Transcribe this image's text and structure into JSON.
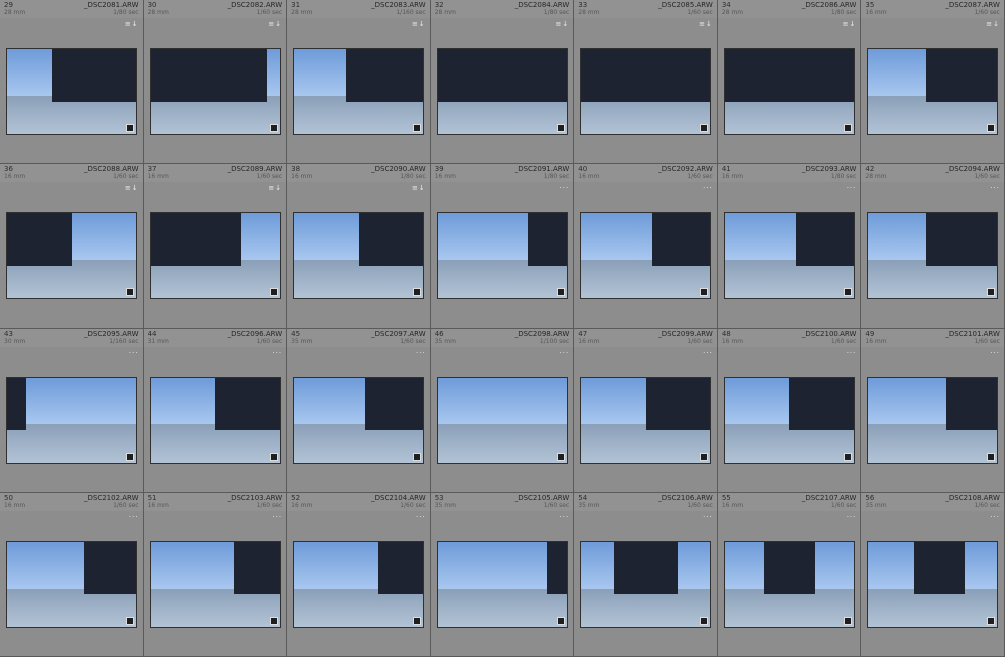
{
  "thumbnails": [
    {
      "index": "29",
      "filename": "_DSC2081.ARW",
      "focal": "28 mm",
      "shutter": "1/80 sec",
      "meta_icon": "≡↓"
    },
    {
      "index": "30",
      "filename": "_DSC2082.ARW",
      "focal": "28 mm",
      "shutter": "1/60 sec",
      "meta_icon": "≡↓"
    },
    {
      "index": "31",
      "filename": "_DSC2083.ARW",
      "focal": "28 mm",
      "shutter": "1/160 sec",
      "meta_icon": "≡↓"
    },
    {
      "index": "32",
      "filename": "_DSC2084.ARW",
      "focal": "28 mm",
      "shutter": "1/80 sec",
      "meta_icon": "≡↓"
    },
    {
      "index": "33",
      "filename": "_DSC2085.ARW",
      "focal": "28 mm",
      "shutter": "1/60 sec",
      "meta_icon": "≡↓"
    },
    {
      "index": "34",
      "filename": "_DSC2086.ARW",
      "focal": "28 mm",
      "shutter": "1/80 sec",
      "meta_icon": "≡↓"
    },
    {
      "index": "35",
      "filename": "_DSC2087.ARW",
      "focal": "16 mm",
      "shutter": "1/60 sec",
      "meta_icon": "≡↓"
    },
    {
      "index": "36",
      "filename": "_DSC2088.ARW",
      "focal": "16 mm",
      "shutter": "1/60 sec",
      "meta_icon": "≡↓"
    },
    {
      "index": "37",
      "filename": "_DSC2089.ARW",
      "focal": "16 mm",
      "shutter": "1/60 sec",
      "meta_icon": "≡↓"
    },
    {
      "index": "38",
      "filename": "_DSC2090.ARW",
      "focal": "16 mm",
      "shutter": "1/80 sec",
      "meta_icon": "≡↓"
    },
    {
      "index": "39",
      "filename": "_DSC2091.ARW",
      "focal": "16 mm",
      "shutter": "1/80 sec",
      "meta_icon": "···"
    },
    {
      "index": "40",
      "filename": "_DSC2092.ARW",
      "focal": "16 mm",
      "shutter": "1/60 sec",
      "meta_icon": "···"
    },
    {
      "index": "41",
      "filename": "_DSC2093.ARW",
      "focal": "16 mm",
      "shutter": "1/80 sec",
      "meta_icon": "···"
    },
    {
      "index": "42",
      "filename": "_DSC2094.ARW",
      "focal": "28 mm",
      "shutter": "1/60 sec",
      "meta_icon": "···"
    },
    {
      "index": "43",
      "filename": "_DSC2095.ARW",
      "focal": "30 mm",
      "shutter": "1/160 sec",
      "meta_icon": "···"
    },
    {
      "index": "44",
      "filename": "_DSC2096.ARW",
      "focal": "31 mm",
      "shutter": "1/60 sec",
      "meta_icon": "···"
    },
    {
      "index": "45",
      "filename": "_DSC2097.ARW",
      "focal": "35 mm",
      "shutter": "1/60 sec",
      "meta_icon": "···"
    },
    {
      "index": "46",
      "filename": "_DSC2098.ARW",
      "focal": "35 mm",
      "shutter": "1/100 sec",
      "meta_icon": "···"
    },
    {
      "index": "47",
      "filename": "_DSC2099.ARW",
      "focal": "16 mm",
      "shutter": "1/60 sec",
      "meta_icon": "···"
    },
    {
      "index": "48",
      "filename": "_DSC2100.ARW",
      "focal": "16 mm",
      "shutter": "1/60 sec",
      "meta_icon": "···"
    },
    {
      "index": "49",
      "filename": "_DSC2101.ARW",
      "focal": "16 mm",
      "shutter": "1/60 sec",
      "meta_icon": "···"
    },
    {
      "index": "50",
      "filename": "_DSC2102.ARW",
      "focal": "16 mm",
      "shutter": "1/60 sec",
      "meta_icon": "···"
    },
    {
      "index": "51",
      "filename": "_DSC2103.ARW",
      "focal": "16 mm",
      "shutter": "1/60 sec",
      "meta_icon": "···"
    },
    {
      "index": "52",
      "filename": "_DSC2104.ARW",
      "focal": "16 mm",
      "shutter": "1/60 sec",
      "meta_icon": "···"
    },
    {
      "index": "53",
      "filename": "_DSC2105.ARW",
      "focal": "35 mm",
      "shutter": "1/60 sec",
      "meta_icon": "···"
    },
    {
      "index": "54",
      "filename": "_DSC2106.ARW",
      "focal": "35 mm",
      "shutter": "1/60 sec",
      "meta_icon": "···"
    },
    {
      "index": "55",
      "filename": "_DSC2107.ARW",
      "focal": "16 mm",
      "shutter": "1/60 sec",
      "meta_icon": "···"
    },
    {
      "index": "56",
      "filename": "_DSC2108.ARW",
      "focal": "35 mm",
      "shutter": "1/60 sec",
      "meta_icon": "···"
    }
  ],
  "colors": {
    "cell_bg": "#8d8d8d",
    "header_bg": "#929292",
    "cell_border": "#5a5a5a",
    "sky": "#6e9bd9",
    "ground": "#b3c3d6",
    "building": "#1d2330"
  }
}
